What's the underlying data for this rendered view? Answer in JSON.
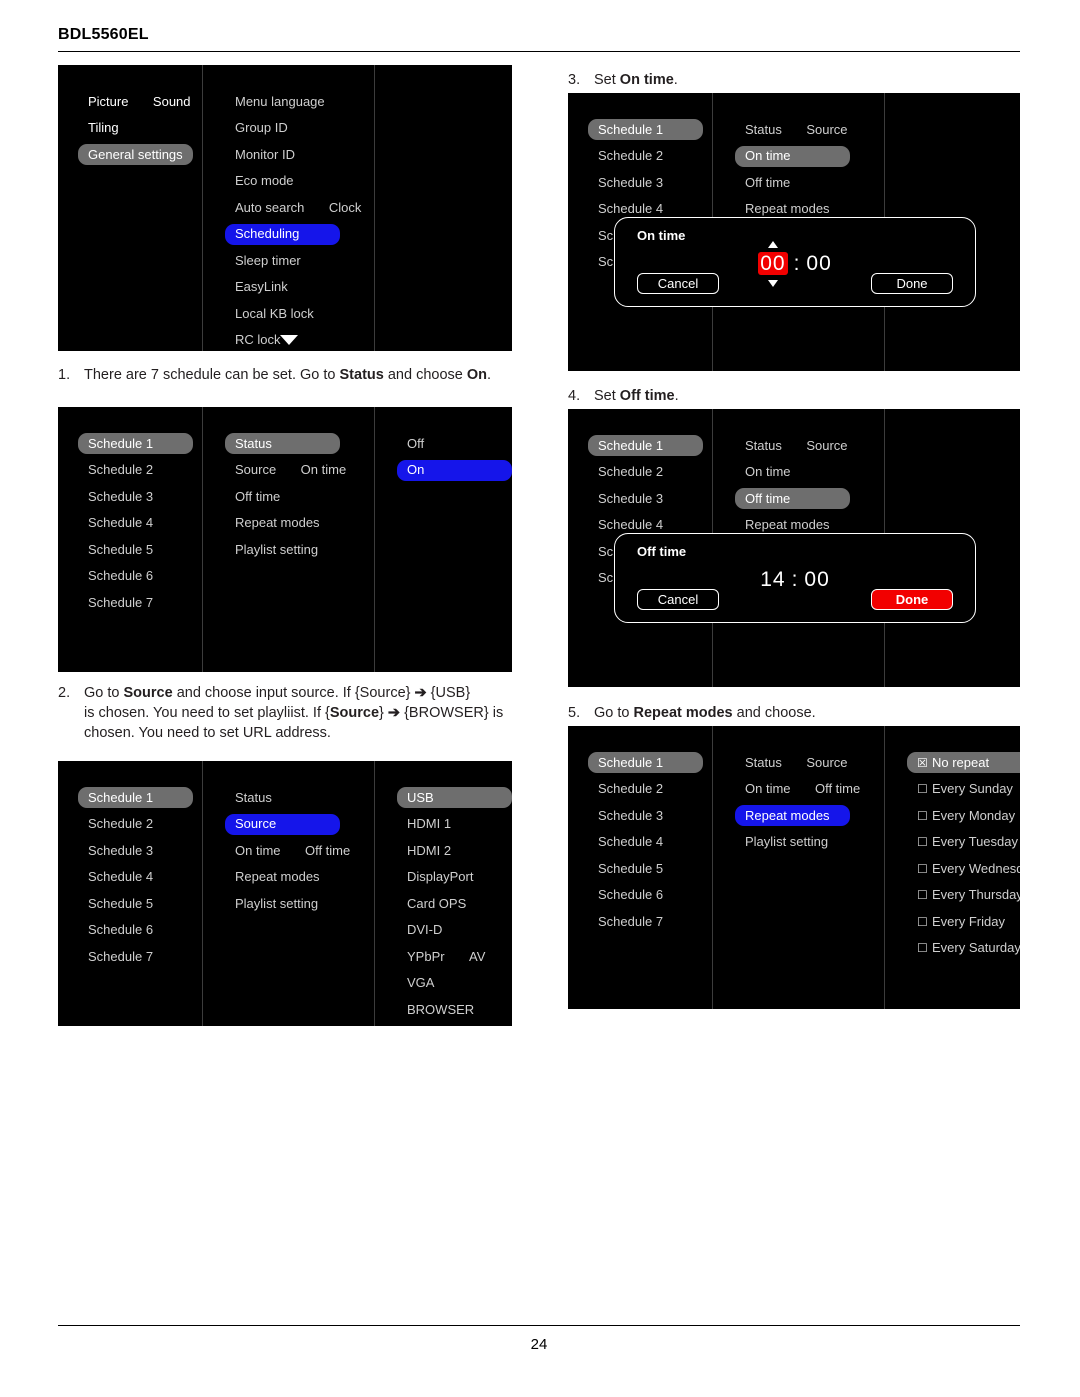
{
  "header": {
    "model": "BDL5560EL"
  },
  "footer": {
    "page_number": "24"
  },
  "osd_general": {
    "left_column": [
      "Picture",
      "Sound",
      "Tiling",
      "General settings"
    ],
    "left_selected": "General settings",
    "middle_column": [
      "Menu language",
      "Group ID",
      "Monitor ID",
      "Eco mode",
      "Auto search",
      "Clock",
      "Scheduling",
      "Sleep timer",
      "EasyLink",
      "Local KB lock",
      "RC lock"
    ],
    "middle_selected": "Scheduling",
    "scroll_icon": "chevron-down-icon"
  },
  "schedules": [
    "Schedule 1",
    "Schedule 2",
    "Schedule 3",
    "Schedule 4",
    "Schedule 5",
    "Schedule 6",
    "Schedule 7"
  ],
  "schedule_fields": [
    "Status",
    "Source",
    "On time",
    "Off time",
    "Repeat modes",
    "Playlist setting"
  ],
  "step1": {
    "number": "1.",
    "text_a": "There are 7 schedule can be set. Go to ",
    "bold_a": "Status",
    "text_b": " and choose ",
    "bold_b": "On",
    "text_c": ".",
    "selected_schedule": "Schedule 1",
    "selected_field": "Status",
    "status_options": [
      "Off",
      "On"
    ],
    "status_selected": "On"
  },
  "step2": {
    "number": "2.",
    "line1_a": "Go to ",
    "line1_bold": "Source",
    "line1_b": " and choose input source. If {Source} ",
    "line1_arrow": "➔",
    "line1_c": " {USB}",
    "line2_a": "is chosen. You need to set playliist. If {",
    "line2_bold": "Source",
    "line2_b": "} ",
    "line2_arrow": "➔",
    "line2_c": " {BROWSER} is",
    "line3": "chosen. You need to set URL address.",
    "selected_schedule": "Schedule 1",
    "selected_field": "Source",
    "source_options": [
      "USB",
      "HDMI 1",
      "HDMI 2",
      "DisplayPort",
      "Card OPS",
      "DVI-D",
      "YPbPr",
      "AV",
      "VGA",
      "BROWSER"
    ],
    "source_selected": "USB"
  },
  "step3": {
    "number": "3.",
    "text_a": "Set ",
    "bold_a": "On time",
    "text_b": ".",
    "selected_schedule": "Schedule 1",
    "selected_field": "On time",
    "truncated_items": [
      "Sche",
      "Sche"
    ],
    "dialog": {
      "title": "On time",
      "hours": "00",
      "separator": ":",
      "minutes": "00",
      "highlight_field": "hours",
      "highlight_color": "#f20000",
      "cancel_label": "Cancel",
      "done_label": "Done",
      "done_active": false,
      "up_icon": "caret-up-icon",
      "down_icon": "caret-down-icon"
    }
  },
  "step4": {
    "number": "4.",
    "text_a": "Set ",
    "bold_a": "Off time",
    "text_b": ".",
    "selected_schedule": "Schedule 1",
    "selected_field": "Off time",
    "truncated_items": [
      "Sche",
      "Sche"
    ],
    "dialog": {
      "title": "Off time",
      "hours": "14",
      "separator": ":",
      "minutes": "00",
      "highlight_field": "none",
      "cancel_label": "Cancel",
      "done_label": "Done",
      "done_active": true
    }
  },
  "step5": {
    "number": "5.",
    "text_a": "Go to ",
    "bold_a": "Repeat modes",
    "text_b": " and choose.",
    "selected_schedule": "Schedule 1",
    "selected_field": "Repeat modes",
    "repeat_options": [
      {
        "label": "No repeat",
        "checked": true
      },
      {
        "label": "Every Sunday",
        "checked": false
      },
      {
        "label": "Every Monday",
        "checked": false
      },
      {
        "label": "Every Tuesday",
        "checked": false
      },
      {
        "label": "Every Wednesday",
        "checked": false
      },
      {
        "label": "Every Thursday",
        "checked": false
      },
      {
        "label": "Every Friday",
        "checked": false
      },
      {
        "label": "Every Saturday",
        "checked": false
      }
    ],
    "checked_glyph": "☒",
    "unchecked_glyph": "☐"
  },
  "colors": {
    "osd_background": "#000000",
    "highlight_blue": "#1515ea",
    "highlight_grey": "#6e6e6e",
    "highlight_red": "#f20000",
    "item_text": "#cfcfcf"
  }
}
